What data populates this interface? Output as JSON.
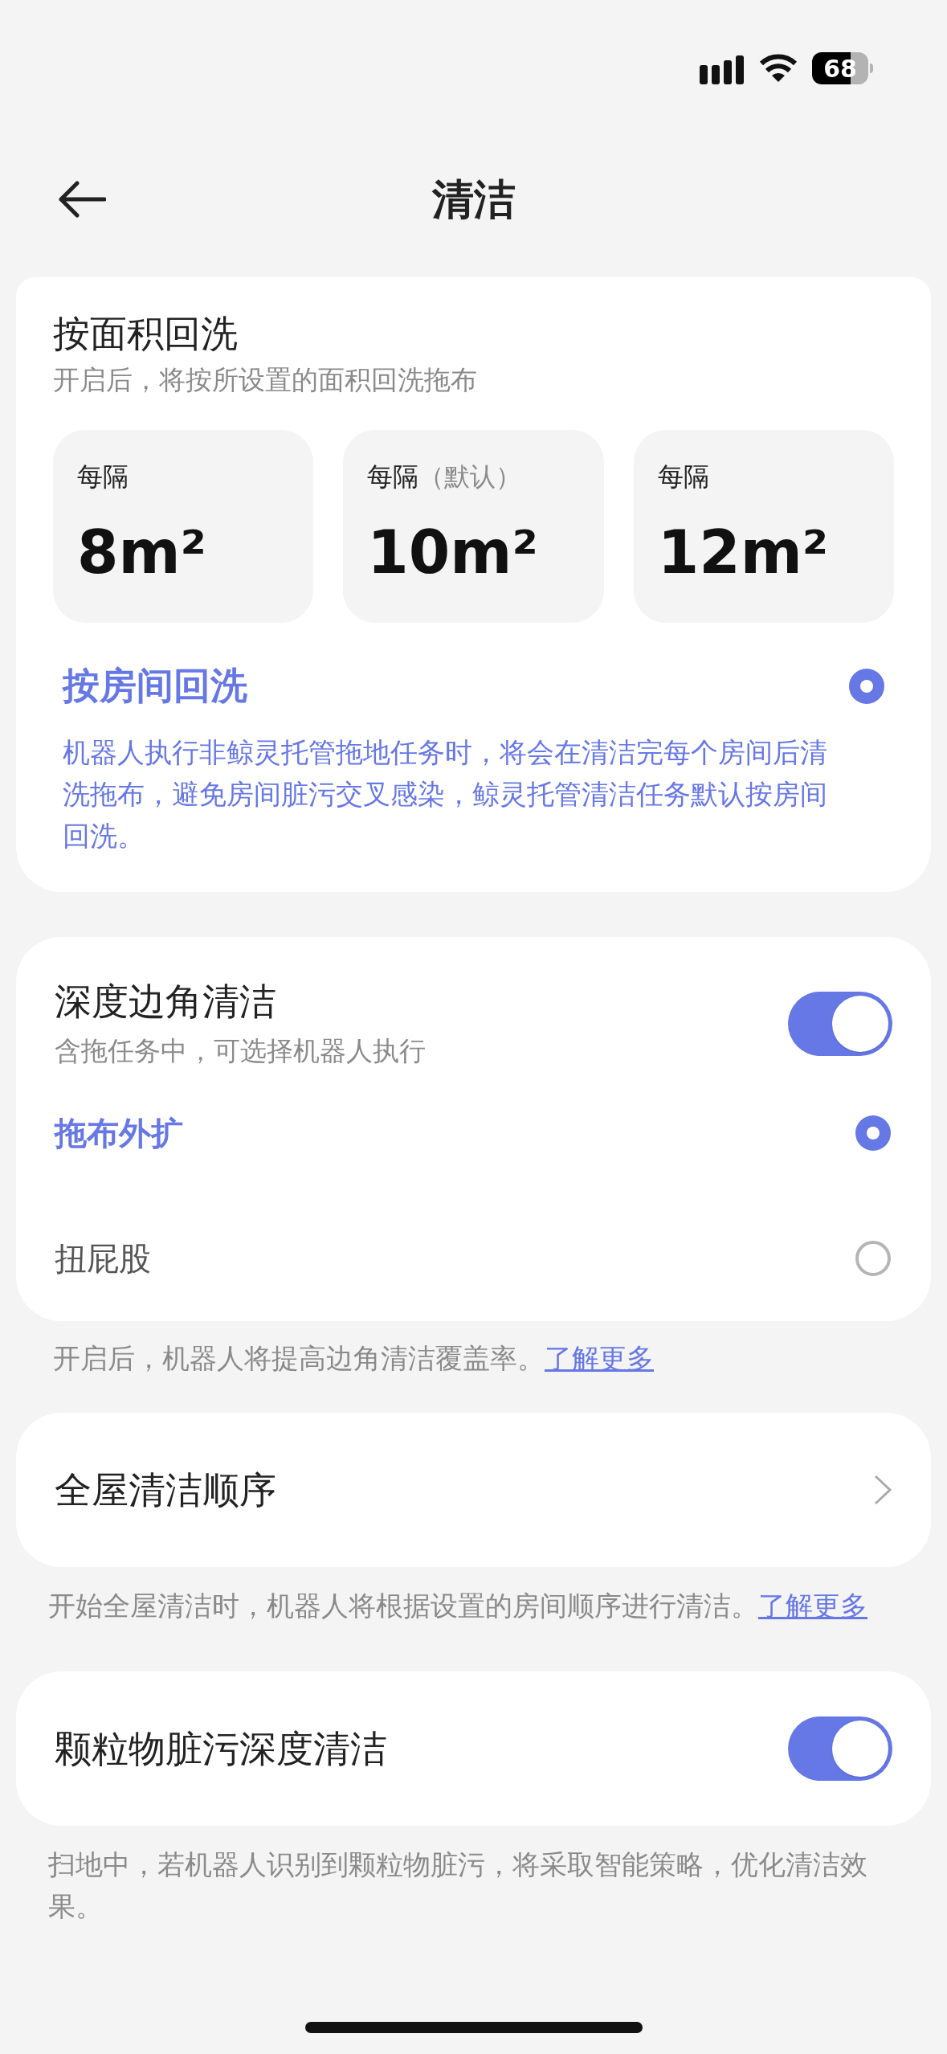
{
  "status_bar": {
    "battery": "68"
  },
  "header": {
    "title": "清洁"
  },
  "wash_card": {
    "area": {
      "title": "按面积回洗",
      "subtitle": "开启后，将按所设置的面积回洗拖布",
      "options": [
        {
          "label": "每隔",
          "value": "8m²",
          "selected": false
        },
        {
          "label": "每隔",
          "note": "（默认）",
          "value": "10m²",
          "selected": false
        },
        {
          "label": "每隔",
          "value": "12m²",
          "selected": false
        }
      ]
    },
    "room": {
      "title": "按房间回洗",
      "selected": true,
      "description": "机器人执行非鲸灵托管拖地任务时，将会在清洁完每个房间后清洗拖布，避免房间脏污交叉感染，鲸灵托管清洁任务默认按房间回洗。"
    }
  },
  "corner_card": {
    "title": "深度边角清洁",
    "subtitle": "含拖任务中，可选择机器人执行",
    "on": true,
    "options": [
      {
        "label": "拖布外扩",
        "selected": true
      },
      {
        "label": "扭屁股",
        "selected": false
      }
    ]
  },
  "corner_note": {
    "text": "开启后，机器人将提高边角清洁覆盖率。",
    "link": "了解更多"
  },
  "order_card": {
    "title": "全屋清洁顺序"
  },
  "order_note": {
    "text": "开始全屋清洁时，机器人将根据设置的房间顺序进行清洁。",
    "link": "了解更多"
  },
  "particle_card": {
    "title": "颗粒物脏污深度清洁",
    "on": true
  },
  "particle_note": {
    "text": "扫地中，若机器人识别到颗粒物脏污，将采取智能策略，优化清洁效果。"
  }
}
